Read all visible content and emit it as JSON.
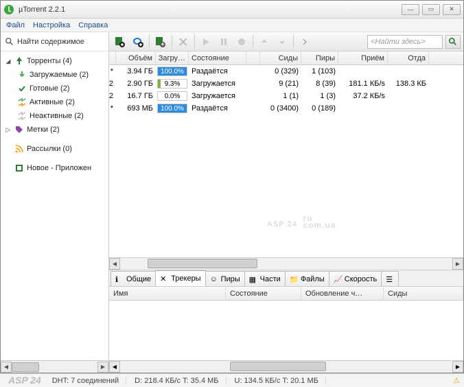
{
  "title": "µTorrent 2.2.1",
  "menu": [
    "Файл",
    "Настройка",
    "Справка"
  ],
  "sidebar": {
    "search_label": "Найти содержимое",
    "items": [
      {
        "label": "Торренты (4)",
        "expand": "◢"
      },
      {
        "label": "Загружаемые (2)"
      },
      {
        "label": "Готовые (2)"
      },
      {
        "label": "Активные (2)"
      },
      {
        "label": "Неактивные (2)"
      },
      {
        "label": "Метки (2)",
        "expand": "▷"
      },
      {
        "label": "Рассылки (0)"
      },
      {
        "label": "Новое - Приложен"
      }
    ]
  },
  "toolbar": {
    "search_placeholder": "<Найти здесь>"
  },
  "grid": {
    "cols": [
      "Объём",
      "Загру…",
      "Состояние",
      "",
      "Сиды",
      "Пиры",
      "Приём",
      "Отда"
    ],
    "rows": [
      {
        "mark": "*",
        "size": "3.94 ГБ",
        "prog": "100.0%",
        "progW": 100,
        "done": true,
        "state": "Раздаётся",
        "c4": "",
        "seeds": "0 (329)",
        "peers": "1 (103)",
        "dl": "",
        "ul": ""
      },
      {
        "mark": "2",
        "size": "2.90 ГБ",
        "prog": "9.3%",
        "progW": 9,
        "done": false,
        "state": "Загружается",
        "c4": "",
        "seeds": "9 (21)",
        "peers": "8 (39)",
        "dl": "181.1 КБ/s",
        "ul": "138.3 КБ"
      },
      {
        "mark": "2",
        "size": "16.7 ГБ",
        "prog": "0.0%",
        "progW": 0,
        "done": false,
        "state": "Загружается",
        "c4": "",
        "seeds": "1 (1)",
        "peers": "1 (3)",
        "dl": "37.2 КБ/s",
        "ul": ""
      },
      {
        "mark": "*",
        "size": "693 МБ",
        "prog": "100.0%",
        "progW": 100,
        "done": true,
        "state": "Раздаётся",
        "c4": "",
        "seeds": "0 (3400)",
        "peers": "0 (189)",
        "dl": "",
        "ul": ""
      }
    ]
  },
  "tabs": [
    "Общие",
    "Трекеры",
    "Пиры",
    "Части",
    "Файлы",
    "Скорость"
  ],
  "detail_cols": [
    "Имя",
    "Состояние",
    "Обновление ч…",
    "Сиды"
  ],
  "status": {
    "asp": "ASP 24",
    "dht": "DHT: 7 соединений",
    "d": "D: 218.4 КБ/с T: 35.4 МБ",
    "u": "U: 134.5 КБ/с T: 20.1 МБ"
  },
  "watermark": "ASP 24",
  "watermark_sub": "ru\ncom.ua"
}
